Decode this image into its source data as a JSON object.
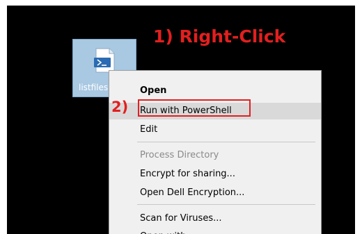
{
  "colors": {
    "desktop_background": "#000000",
    "annotation_red": "#e21f1f",
    "selection_tile": "#a9c8e2",
    "menu_background": "#f0f0f0",
    "menu_hover": "#d9d9d9",
    "disabled_text": "#8a8a8a"
  },
  "desktop": {
    "file": {
      "label": "listfiles",
      "icon": "powershell-script-icon"
    }
  },
  "annotations": {
    "step1": "1) Right-Click",
    "step2": "2)"
  },
  "context_menu": {
    "items": [
      {
        "label": "Open",
        "style": "bold"
      },
      {
        "label": "Run with PowerShell",
        "style": "hover-highlighted"
      },
      {
        "label": "Edit",
        "style": "normal"
      },
      {
        "label": "Process Directory",
        "style": "disabled"
      },
      {
        "label": "Encrypt for sharing...",
        "style": "normal"
      },
      {
        "label": "Open Dell Encryption...",
        "style": "normal"
      },
      {
        "label": "Scan for Viruses...",
        "style": "normal"
      },
      {
        "label": "Open with...",
        "style": "normal"
      }
    ]
  }
}
